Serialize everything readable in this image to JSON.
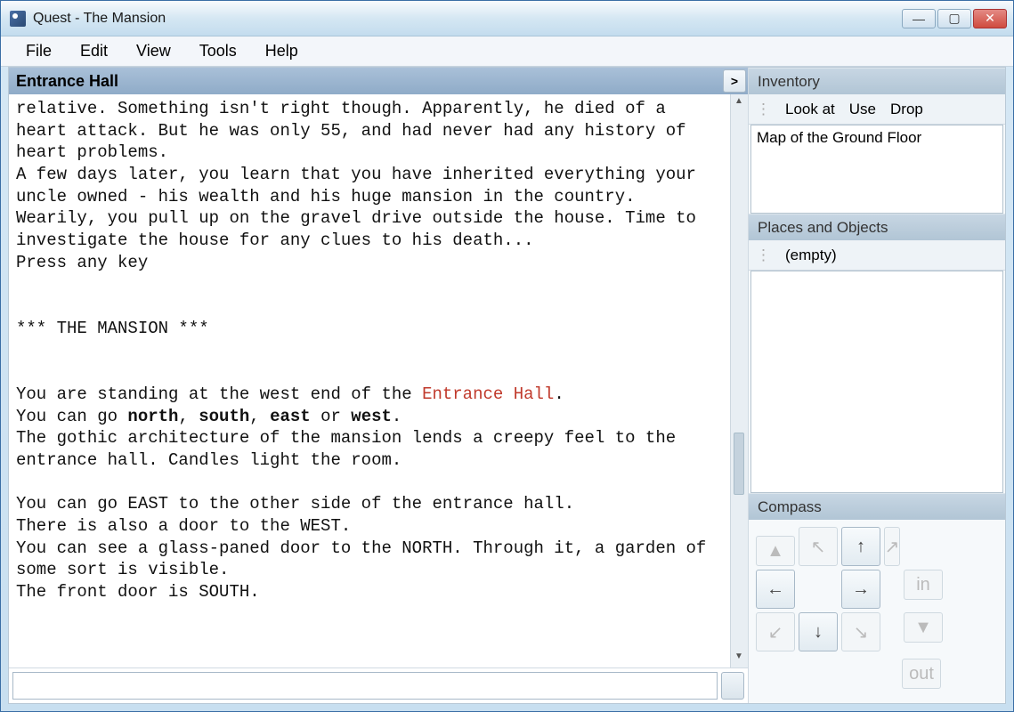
{
  "window": {
    "title": "Quest - The Mansion"
  },
  "menu": {
    "file": "File",
    "edit": "Edit",
    "view": "View",
    "tools": "Tools",
    "help": "Help"
  },
  "location": {
    "name": "Entrance Hall",
    "toggle": ">"
  },
  "story": {
    "p1": "relative. Something isn't right though. Apparently, he died of a heart attack. But he was only 55, and had never had any history of heart problems.",
    "p2": "A few days later, you learn that you have inherited everything your uncle owned - his wealth and his huge mansion in the country. Wearily, you pull up on the gravel drive outside the house. Time to investigate the house for any clues to his death...",
    "p3": "Press any key",
    "banner": "*** THE MANSION ***",
    "stand1": "You are standing at the west end of the ",
    "locname": "Entrance Hall",
    "stand2": ".",
    "go_pre": "You can go ",
    "north": "north",
    "comma1": ", ",
    "south": "south",
    "comma2": ", ",
    "east": "east",
    "or": " or ",
    "west": "west",
    "period": ".",
    "desc1": "The gothic architecture of the mansion lends a creepy feel to the entrance hall. Candles light the room.",
    "d_east": "You can go EAST to the other side of the entrance hall.",
    "d_west": "There is also a door to the WEST.",
    "d_north": "You can see a glass-paned door to the NORTH. Through it, a garden of some sort is visible.",
    "d_south": "The front door is SOUTH."
  },
  "input": {
    "value": ""
  },
  "inventory": {
    "title": "Inventory",
    "actions": {
      "look": "Look at",
      "use": "Use",
      "drop": "Drop"
    },
    "items": [
      "Map of the Ground Floor"
    ]
  },
  "places": {
    "title": "Places and Objects",
    "empty": "(empty)"
  },
  "compass": {
    "title": "Compass",
    "nw": "↖",
    "n": "↑",
    "ne": "↗",
    "w": "←",
    "e": "→",
    "sw": "↙",
    "s": "↓",
    "se": "↘",
    "up": "▲",
    "in": "in",
    "down": "▼",
    "out": "out"
  }
}
